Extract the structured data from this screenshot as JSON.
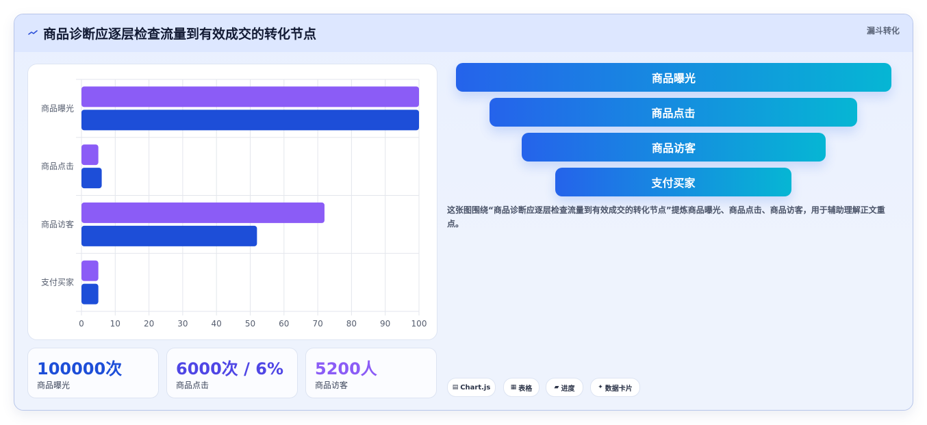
{
  "header": {
    "title": "商品诊断应逐层检查流量到有效成交的转化节点",
    "tag": "漏斗转化"
  },
  "chart_data": {
    "type": "bar",
    "orientation": "horizontal",
    "categories": [
      "商品曝光",
      "商品点击",
      "商品访客",
      "支付买家"
    ],
    "series": [
      {
        "values": [
          100,
          5,
          72,
          5
        ],
        "color": "#8b5cf6"
      },
      {
        "values": [
          100,
          6,
          52,
          5
        ],
        "color": "#1d4ed8"
      }
    ],
    "xlim": [
      0,
      100
    ],
    "xticks": [
      0,
      10,
      20,
      30,
      40,
      50,
      60,
      70,
      80,
      90,
      100
    ],
    "grid": true,
    "legend": "none"
  },
  "stats": [
    {
      "value": "100000次",
      "label": "商品曝光",
      "color": "#1d4ed8"
    },
    {
      "value": "6000次 / 6%",
      "label": "商品点击",
      "color": "#4f46e5"
    },
    {
      "value": "5200人",
      "label": "商品访客",
      "color": "#8b5cf6"
    }
  ],
  "funnel": [
    {
      "label": "商品曝光"
    },
    {
      "label": "商品点击"
    },
    {
      "label": "商品访客"
    },
    {
      "label": "支付买家"
    }
  ],
  "description": "这张图围绕“商品诊断应逐层检查流量到有效成交的转化节点”提炼商品曝光、商品点击、商品访客，用于辅助理解正文重点。",
  "chips": [
    {
      "icon": "chart-icon",
      "glyph": "▤",
      "label": "Chart.js"
    },
    {
      "icon": "table-icon",
      "glyph": "▦",
      "label": "表格"
    },
    {
      "icon": "progress-icon",
      "glyph": "▰",
      "label": "进度"
    },
    {
      "icon": "sparkle-icon",
      "glyph": "✦",
      "label": "数据卡片"
    }
  ]
}
